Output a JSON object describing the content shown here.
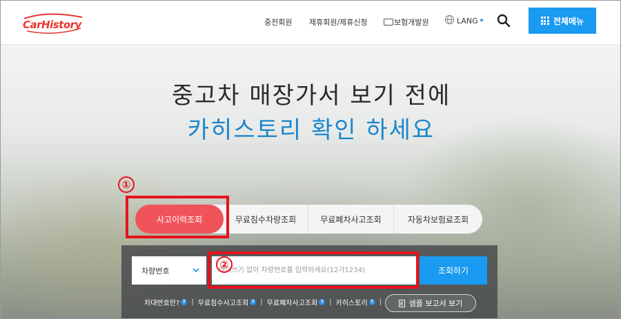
{
  "header": {
    "logo_text": "CarHistory",
    "nav": [
      {
        "label": "중전회원"
      },
      {
        "label": "제휴회원/제휴신청"
      },
      {
        "label": "보험개발원"
      },
      {
        "label": "LANG"
      }
    ],
    "menu_label": "전체메뉴",
    "icons": {
      "globe": "globe-icon",
      "search": "search-icon",
      "menu": "grid-icon"
    }
  },
  "hero": {
    "headline_1": "중고차 매장가서 보기 전에",
    "headline_2": "카히스토리 확인 하세요"
  },
  "tabs": [
    {
      "label": "사고이력조회",
      "active": true
    },
    {
      "label": "무료침수차량조회"
    },
    {
      "label": "무료폐차사고조회"
    },
    {
      "label": "자동차보험료조회"
    }
  ],
  "search": {
    "select_value": "차량번호",
    "placeholder": "띄어쓰기 없이 차량번호를 입력하세요(12가1234)",
    "submit_label": "조회하기"
  },
  "links": [
    {
      "label": "차대번호란?"
    },
    {
      "label": "무료침수사고조회"
    },
    {
      "label": "무료폐차사고조회"
    },
    {
      "label": "카히스토리"
    }
  ],
  "sample_label": "샘플 보고서 보기",
  "annotations": [
    {
      "number": "①"
    },
    {
      "number": "②"
    }
  ],
  "colors": {
    "accent_blue": "#1a9af0",
    "active_tab": "#f0545a",
    "annotation_red": "#e8111b",
    "headline_blue": "#1a86cc"
  }
}
